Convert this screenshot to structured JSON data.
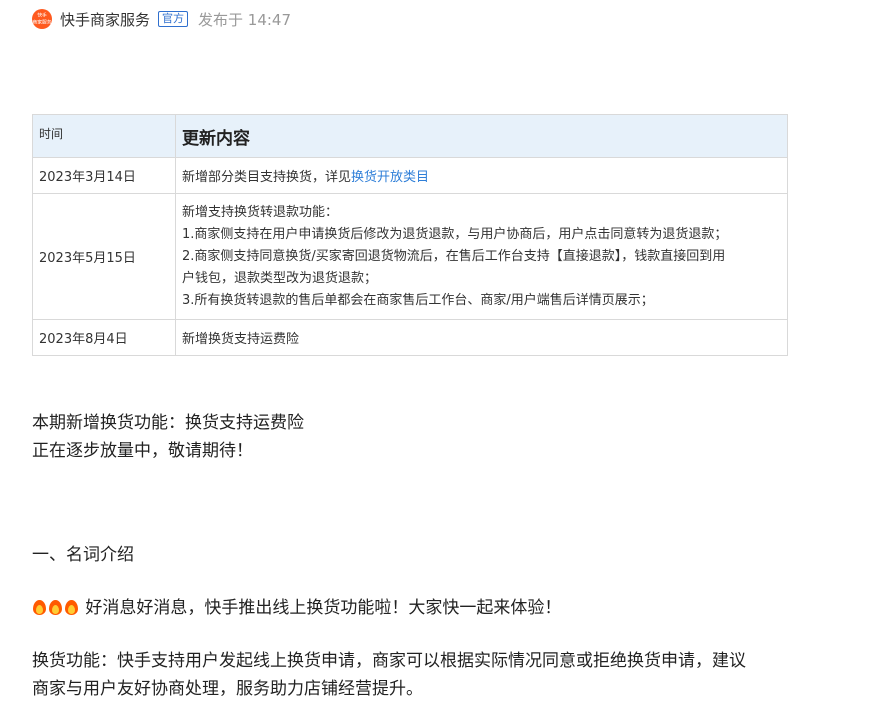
{
  "post": {
    "avatar_line1": "快手",
    "avatar_line2": "商家服务",
    "author": "快手商家服务",
    "badge": "官方",
    "published": "发布于 14:47"
  },
  "table": {
    "header_time": "时间",
    "header_content": "更新内容",
    "rows": [
      {
        "date": "2023年3月14日",
        "text": "新增部分类目支持换货，详见",
        "link": "换货开放类目"
      },
      {
        "date": "2023年5月15日",
        "lines": [
          "新增支持换货转退款功能：",
          "1.商家侧支持在用户申请换货后修改为退货退款，与用户协商后，用户点击同意转为退货退款；",
          "2.商家侧支持同意换货/买家寄回退货物流后，在售后工作台支持【直接退款】，钱款直接回到用",
          "户钱包，退款类型改为退货退款；",
          "3.所有换货转退款的售后单都会在商家售后工作台、商家/用户端售后详情页展示；"
        ]
      },
      {
        "date": "2023年8月4日",
        "text": "新增换货支持运费险"
      }
    ]
  },
  "body": {
    "line1": "本期新增换货功能：换货支持运费险",
    "line2": "正在逐步放量中，敬请期待！",
    "section_title": "一、名词介绍",
    "fire_icons": [
      "fire-icon",
      "fire-icon",
      "fire-icon"
    ],
    "good_news": "好消息好消息，快手推出线上换货功能啦！大家快一起来体验！",
    "desc_line1": "换货功能：快手支持用户发起线上换货申请，商家可以根据实际情况同意或拒绝换货申请，建议",
    "desc_line2": "商家与用户友好协商处理，服务助力店铺经营提升。"
  }
}
